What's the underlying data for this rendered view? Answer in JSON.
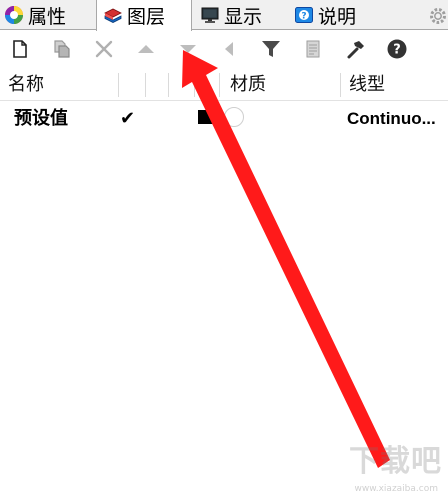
{
  "tabs": [
    {
      "label": "属性",
      "icon": "properties-color-wheel-icon"
    },
    {
      "label": "图层",
      "icon": "layers-icon",
      "active": true
    },
    {
      "label": "显示",
      "icon": "display-monitor-icon"
    },
    {
      "label": "说明",
      "icon": "help-description-icon"
    }
  ],
  "toolbar": {
    "buttons": [
      "new-layer-icon",
      "new-sublayer-icon",
      "delete-icon",
      "move-up-icon",
      "move-down-icon",
      "move-to-parent-icon",
      "filter-icon",
      "layer-state-icon",
      "tools-hammer-icon",
      "help-icon"
    ]
  },
  "table": {
    "columns": {
      "name": "名称",
      "material": "材质",
      "linetype": "线型"
    },
    "rows": [
      {
        "name": "预设值",
        "current": "✔",
        "color": "#000000",
        "linetype": "Continuo..."
      }
    ]
  },
  "annotation": {
    "arrow_color": "#ff1a1a"
  },
  "watermark": {
    "text": "下载吧",
    "url": "www.xiazaiba.com"
  }
}
